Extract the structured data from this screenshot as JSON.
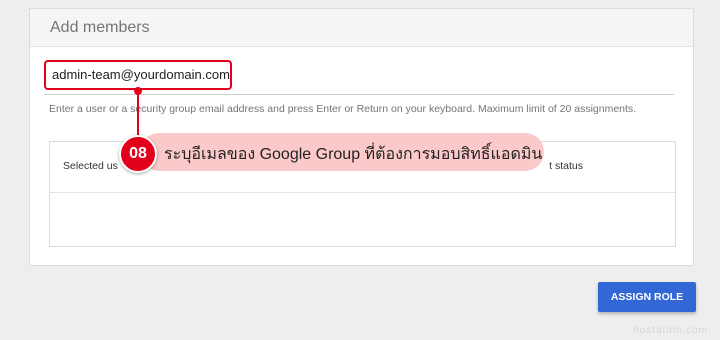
{
  "panel": {
    "title": "Add members"
  },
  "members_input": {
    "value": "admin-team@yourdomain.com",
    "hint": "Enter a user or a security group email address and press Enter or Return on your keyboard. Maximum limit of 20 assignments."
  },
  "table": {
    "col_selected": "Selected us",
    "col_status": "t status"
  },
  "annotation": {
    "step": "08",
    "text": "ระบุอีเมลของ Google Group ที่ต้องการมอบสิทธิ์แอดมิน"
  },
  "actions": {
    "assign_role_label": "ASSIGN ROLE"
  },
  "watermark": "hostatom.com",
  "colors": {
    "accent_blue": "#3367d6",
    "highlight_red": "#e3001b",
    "callout_pink": "#fbc9c9"
  }
}
